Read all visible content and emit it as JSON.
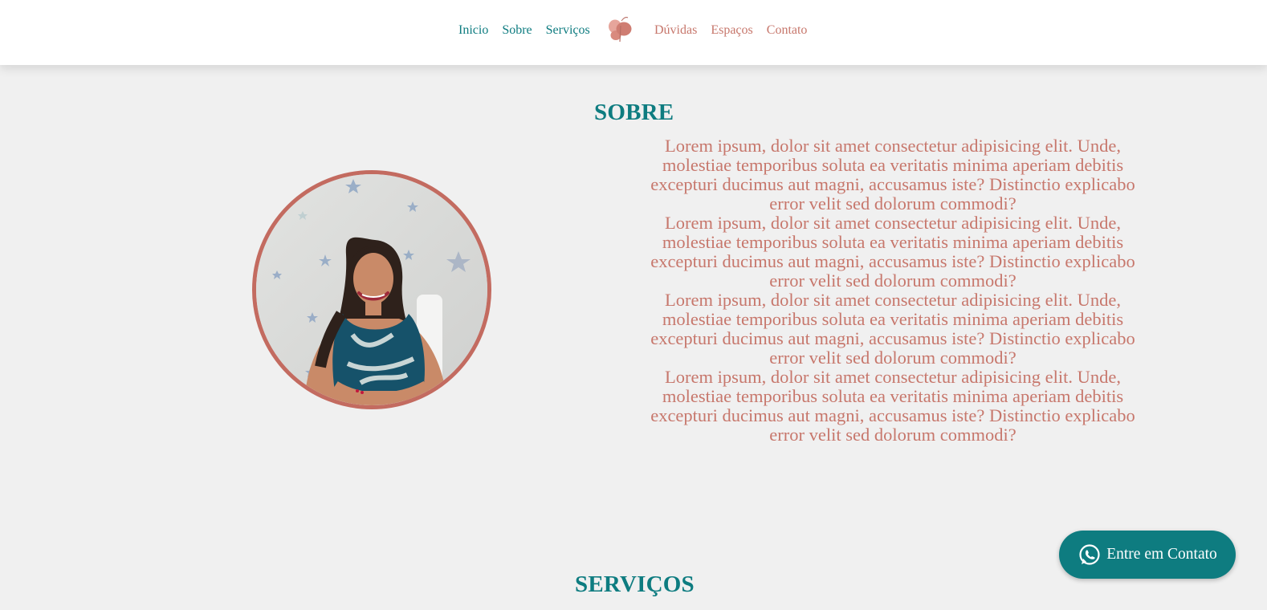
{
  "nav": {
    "left_items": [
      {
        "label": "Inicio"
      },
      {
        "label": "Sobre"
      },
      {
        "label": "Serviços"
      }
    ],
    "logo_icon": "butterfly-logo-icon",
    "right_items": [
      {
        "label": "Dúvidas"
      },
      {
        "label": "Espaços"
      },
      {
        "label": "Contato"
      }
    ]
  },
  "sobre": {
    "title": "SOBRE",
    "photo_icon": "profile-photo",
    "paragraphs": [
      "Lorem ipsum, dolor sit amet consectetur adipisicing elit. Unde, molestiae temporibus soluta ea veritatis minima aperiam debitis excepturi ducimus aut magni, accusamus iste? Distinctio explicabo error velit sed dolorum commodi?",
      "Lorem ipsum, dolor sit amet consectetur adipisicing elit. Unde, molestiae temporibus soluta ea veritatis minima aperiam debitis excepturi ducimus aut magni, accusamus iste? Distinctio explicabo error velit sed dolorum commodi?",
      "Lorem ipsum, dolor sit amet consectetur adipisicing elit. Unde, molestiae temporibus soluta ea veritatis minima aperiam debitis excepturi ducimus aut magni, accusamus iste? Distinctio explicabo error velit sed dolorum commodi?",
      "Lorem ipsum, dolor sit amet consectetur adipisicing elit. Unde, molestiae temporibus soluta ea veritatis minima aperiam debitis excepturi ducimus aut magni, accusamus iste? Distinctio explicabo error velit sed dolorum commodi?"
    ]
  },
  "servicos": {
    "title": "SERVIÇOS"
  },
  "cta": {
    "label": "Entre em Contato",
    "icon": "whatsapp-icon"
  },
  "colors": {
    "teal": "#0e7c80",
    "rose": "#c7776c",
    "background": "#f0f0f0"
  }
}
